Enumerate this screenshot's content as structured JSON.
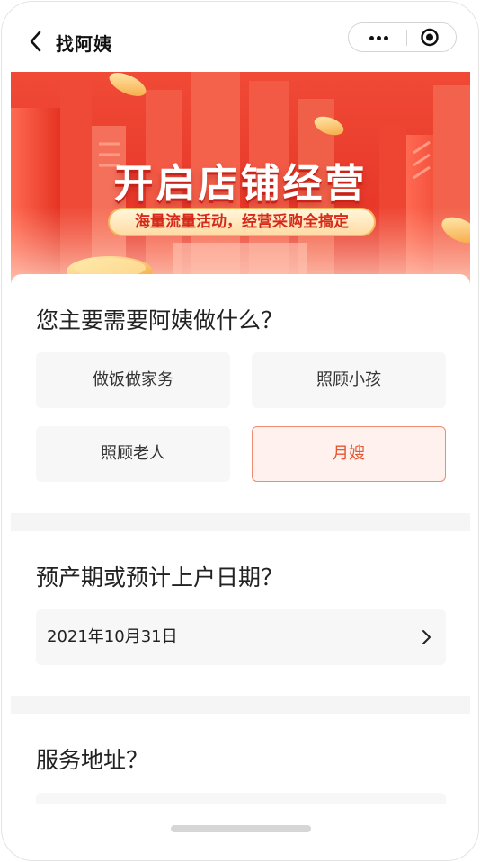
{
  "nav": {
    "title": "找阿姨",
    "back_icon": "chevron-left-icon",
    "more_icon": "more-dots-icon",
    "target_icon": "record-target-icon"
  },
  "banner": {
    "title": "开启店铺经营",
    "subtitle": "海量流量活动，经营采购全搞定",
    "colors": {
      "background": "#ea3c2d",
      "pill": "#ffe3b0",
      "pill_text": "#d6291a"
    }
  },
  "service": {
    "question": "您主要需要阿姨做什么？",
    "options": [
      {
        "label": "做饭做家务",
        "selected": false
      },
      {
        "label": "照顾小孩",
        "selected": false
      },
      {
        "label": "照顾老人",
        "selected": false
      },
      {
        "label": "月嫂",
        "selected": true
      }
    ],
    "accent": "#e8552e"
  },
  "date": {
    "question": "预产期或预计上户日期？",
    "value": "2021年10月31日",
    "chevron_icon": "chevron-right-icon"
  },
  "address": {
    "question": "服务地址？"
  }
}
